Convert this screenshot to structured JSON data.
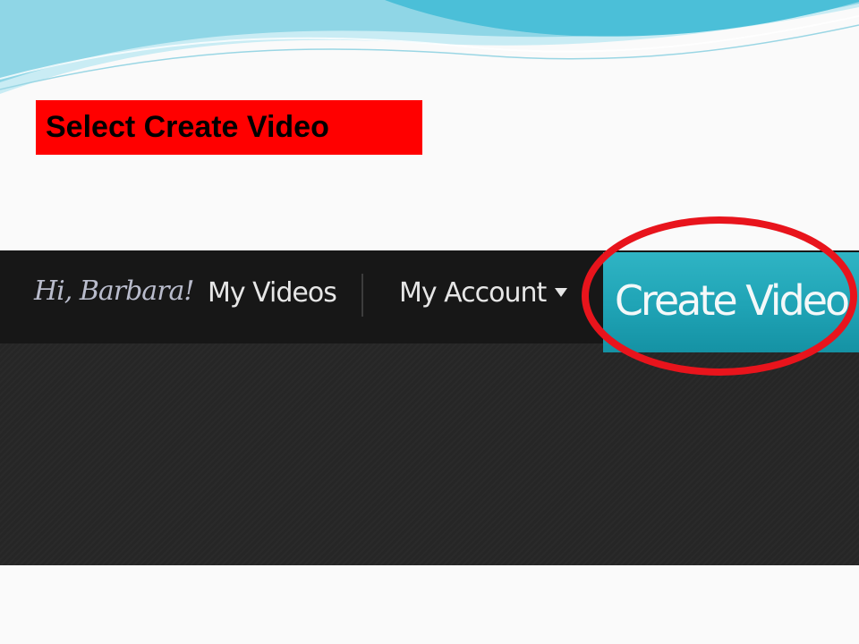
{
  "slide": {
    "instruction": "Select Create Video",
    "instruction_bg": "#ff0000"
  },
  "navbar": {
    "greeting": "Hi, Barbara!",
    "links": [
      {
        "label": "My Videos"
      },
      {
        "label": "My Account",
        "icon": "caret-down-icon"
      }
    ],
    "primary_button": {
      "label": "Create Video",
      "color": "#1fa3b5"
    }
  },
  "annotation": {
    "shape": "oval",
    "color": "#e8141c",
    "target": "create-video-button"
  }
}
